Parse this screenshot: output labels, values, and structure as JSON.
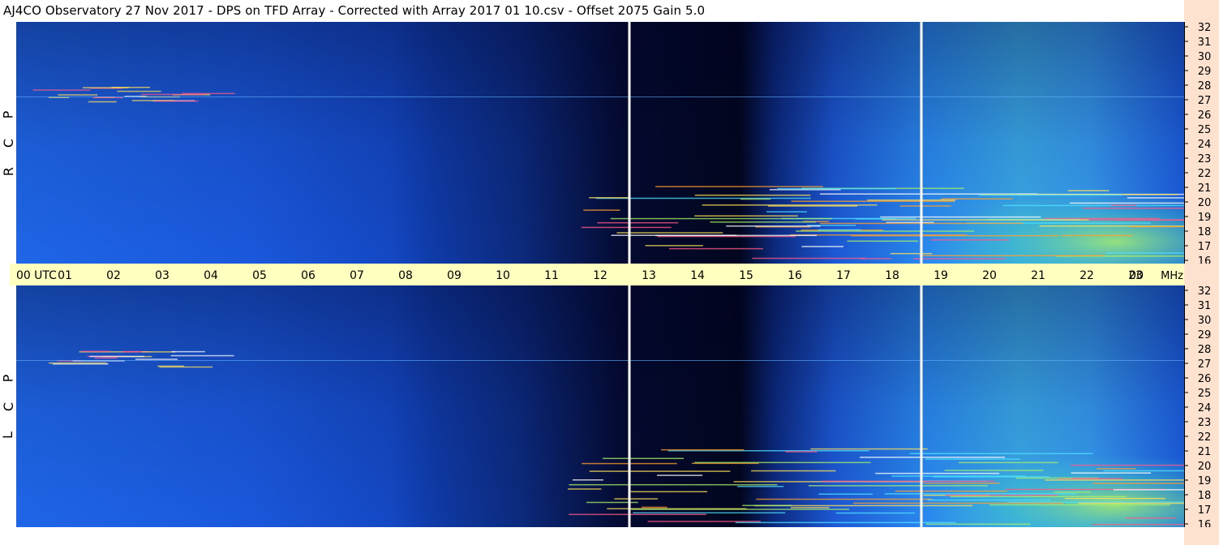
{
  "title": "AJ4CO Observatory  27 Nov 2017  -  DPS on TFD Array  -  Corrected with Array 2017 01 10.csv  -  Offset 2075  Gain 5.0",
  "colors": {
    "background_low": "#0a1a5a",
    "background_mid": "#1550d8",
    "background_high": "#2a8cff",
    "hot": "#a8f06a",
    "axis_band": "#ffffc0",
    "right_strip": "#fde2cf",
    "cursor": "#ffffff"
  },
  "panels": [
    {
      "id": "rcp",
      "label_letters": [
        "R",
        "C",
        "P"
      ]
    },
    {
      "id": "lcp",
      "label_letters": [
        "L",
        "C",
        "P"
      ]
    }
  ],
  "chart_data": {
    "type": "heatmap",
    "title": "AJ4CO Observatory  27 Nov 2017  -  DPS on TFD Array  -  Corrected with Array 2017 01 10.csv  -  Offset 2075  Gain 5.0",
    "x_axis": {
      "unit_label": "UTC",
      "tick_labels": [
        "00",
        "01",
        "02",
        "03",
        "04",
        "05",
        "06",
        "07",
        "08",
        "09",
        "10",
        "11",
        "12",
        "13",
        "14",
        "15",
        "16",
        "17",
        "18",
        "19",
        "20",
        "21",
        "22",
        "23",
        "00"
      ],
      "range": [
        0,
        24
      ]
    },
    "y_axis": {
      "unit_label": "MHz",
      "tick_labels": [
        "16",
        "17",
        "18",
        "19",
        "20",
        "21",
        "22",
        "23",
        "24",
        "25",
        "26",
        "27",
        "28",
        "29",
        "30",
        "31",
        "32"
      ],
      "range": [
        16,
        32
      ]
    },
    "series": [
      {
        "name": "R C P"
      },
      {
        "name": "L C P"
      }
    ],
    "cursor_lines_utc": [
      12.6,
      18.6
    ]
  }
}
